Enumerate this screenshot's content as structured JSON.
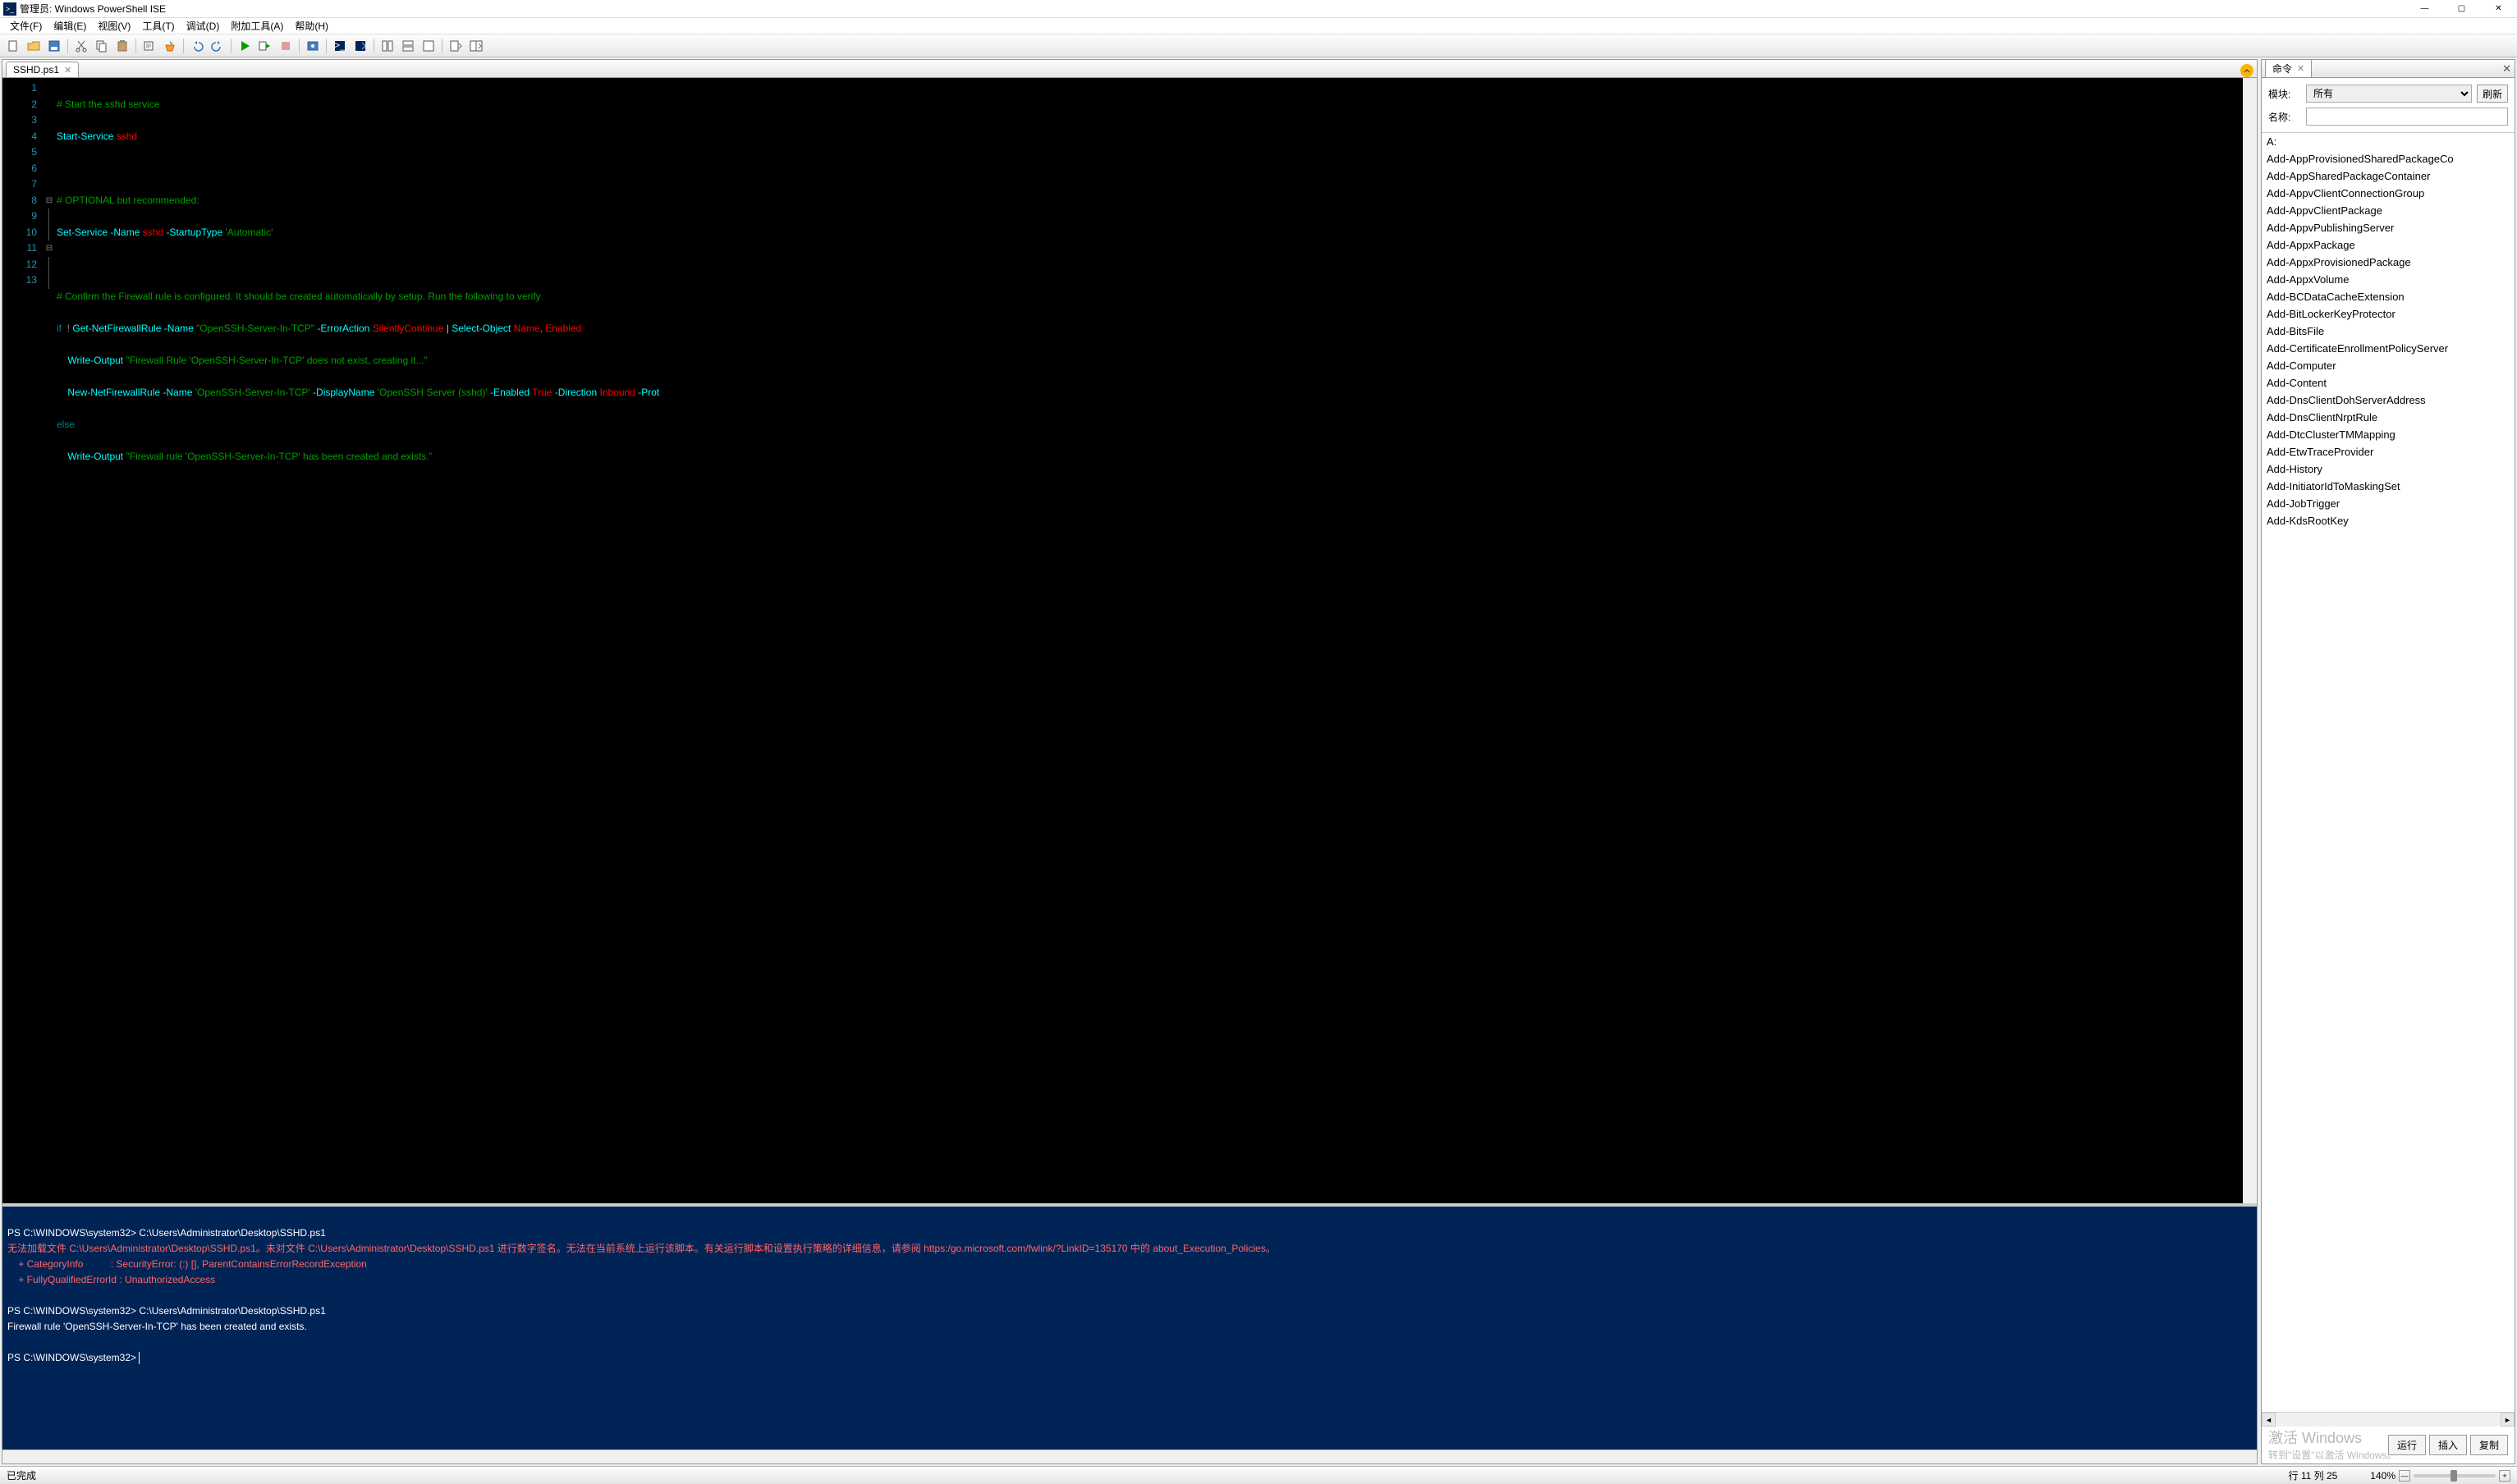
{
  "window": {
    "title": "管理员: Windows PowerShell ISE"
  },
  "menu": {
    "file": "文件(F)",
    "edit": "编辑(E)",
    "view": "视图(V)",
    "tools": "工具(T)",
    "debug": "调试(D)",
    "addons": "附加工具(A)",
    "help": "帮助(H)"
  },
  "tabs": {
    "file1": "SSHD.ps1"
  },
  "editor": {
    "line_numbers": [
      "1",
      "2",
      "3",
      "4",
      "5",
      "6",
      "7",
      "8",
      "9",
      "10",
      "11",
      "12",
      "13"
    ],
    "fold": {
      "8": "⊟",
      "11": "⊟"
    },
    "lines": {
      "1": {
        "comment": "# Start the sshd service"
      },
      "2": {
        "cmd": "Start-Service",
        "arg": "sshd"
      },
      "4": {
        "comment": "# OPTIONAL but recommended:"
      },
      "5": {
        "cmd": "Set-Service",
        "p1": "-Name",
        "a1": "sshd",
        "p2": "-StartupType",
        "s1": "'Automatic'"
      },
      "7": {
        "comment": "# Confirm the Firewall rule is configured. It should be created automatically by setup. Run the following to verify"
      },
      "8": {
        "kw1": "if",
        "op": "!",
        "cmd": "Get-NetFirewallRule",
        "p1": "-Name",
        "s1": "\"OpenSSH-Server-In-TCP\"",
        "p2": "-ErrorAction",
        "a1": "SilentlyContinue",
        "pipe": "|",
        "cmd2": "Select-Object",
        "prop1": "Name",
        "comma": ",",
        "prop2": "Enabled"
      },
      "9": {
        "cmd": "Write-Output",
        "s1": "\"Firewall Rule 'OpenSSH-Server-In-TCP' does not exist, creating it...\""
      },
      "10": {
        "cmd": "New-NetFirewallRule",
        "p1": "-Name",
        "s1": "'OpenSSH-Server-In-TCP'",
        "p2": "-DisplayName",
        "s2": "'OpenSSH Server (sshd)'",
        "p3": "-Enabled",
        "a1": "True",
        "p4": "-Direction",
        "a2": "Inbound",
        "p5": "-Prot"
      },
      "11": {
        "kw": "else"
      },
      "12": {
        "cmd": "Write-Output",
        "s1": "\"Firewall rule 'OpenSSH-Server-In-TCP' has been created and exists.\""
      }
    }
  },
  "console": {
    "prompt1": "PS C:\\WINDOWS\\system32> ",
    "cmd1": "C:\\Users\\Administrator\\Desktop\\SSHD.ps1",
    "err1": "无法加载文件 C:\\Users\\Administrator\\Desktop\\SSHD.ps1。未对文件 C:\\Users\\Administrator\\Desktop\\SSHD.ps1 进行数字签名。无法在当前系统上运行该脚本。有关运行脚本和设置执行策略的详细信息，请参阅 https:/go.microsoft.com/fwlink/?LinkID=135170 中的 about_Execution_Policies。",
    "err2": "    + CategoryInfo          : SecurityError: (:) [], ParentContainsErrorRecordException",
    "err3": "    + FullyQualifiedErrorId : UnauthorizedAccess",
    "prompt2": "PS C:\\WINDOWS\\system32> ",
    "cmd2": "C:\\Users\\Administrator\\Desktop\\SSHD.ps1",
    "out1": "Firewall rule 'OpenSSH-Server-In-TCP' has been created and exists.",
    "prompt3": "PS C:\\WINDOWS\\system32> "
  },
  "commands_panel": {
    "tab": "命令",
    "module_label": "模块:",
    "module_value": "所有",
    "refresh": "刷新",
    "name_label": "名称:",
    "name_value": "",
    "items": [
      "A:",
      "Add-AppProvisionedSharedPackageCo",
      "Add-AppSharedPackageContainer",
      "Add-AppvClientConnectionGroup",
      "Add-AppvClientPackage",
      "Add-AppvPublishingServer",
      "Add-AppxPackage",
      "Add-AppxProvisionedPackage",
      "Add-AppxVolume",
      "Add-BCDataCacheExtension",
      "Add-BitLockerKeyProtector",
      "Add-BitsFile",
      "Add-CertificateEnrollmentPolicyServer",
      "Add-Computer",
      "Add-Content",
      "Add-DnsClientDohServerAddress",
      "Add-DnsClientNrptRule",
      "Add-DtcClusterTMMapping",
      "Add-EtwTraceProvider",
      "Add-History",
      "Add-InitiatorIdToMaskingSet",
      "Add-JobTrigger",
      "Add-KdsRootKey"
    ],
    "run": "运行",
    "insert": "插入",
    "copy": "复制"
  },
  "watermark": {
    "line1": "激活 Windows",
    "line2": "转到\"设置\"以激活 Windows。"
  },
  "status": {
    "left": "已完成",
    "pos": "行 11 列 25",
    "zoom": "140%"
  }
}
